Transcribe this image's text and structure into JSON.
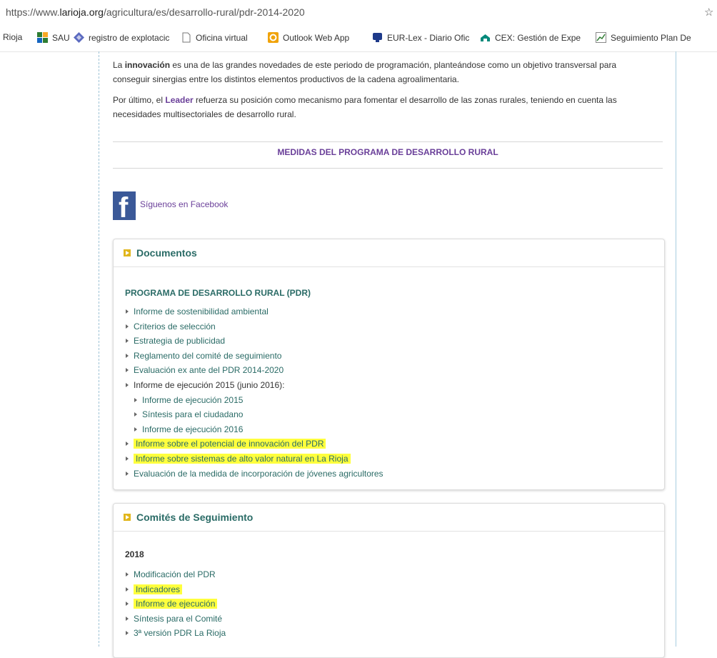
{
  "browser": {
    "url_prefix": "https://www.",
    "url_domain": "larioja.org",
    "url_path": "/agricultura/es/desarrollo-rural/pdr-2014-2020",
    "bookmarks": [
      {
        "label": "Rioja",
        "icon": "none"
      },
      {
        "label": "SAU",
        "icon": "sau-grid-icon"
      },
      {
        "label": "registro de explotacic",
        "icon": "diamond-icon"
      },
      {
        "label": "Oficina virtual",
        "icon": "page-icon"
      },
      {
        "label": "Outlook Web App",
        "icon": "outlook-icon"
      },
      {
        "label": "EUR-Lex - Diario Ofic",
        "icon": "eurlex-icon"
      },
      {
        "label": "CEX: Gestión de Expe",
        "icon": "cex-icon"
      },
      {
        "label": "Seguimiento Plan De",
        "icon": "chart-icon"
      }
    ]
  },
  "intro": {
    "p1_bold": "innovación",
    "p1_before": "La ",
    "p1_after_line1": " es una de las grandes novedades de este periodo de programación, planteándose como un objetivo transversal para",
    "p1_line2": "conseguir sinergias entre los distintos elementos productivos de la cadena agroalimentaria.",
    "p2_before": "Por último, el ",
    "p2_link": "Leader",
    "p2_after_line1": " refuerza su posición como mecanismo para fomentar el desarrollo de las zonas rurales, teniendo en cuenta las",
    "p2_line2": "necesidades multisectoriales de desarrollo rural."
  },
  "medidas_title": "MEDIDAS DEL PROGRAMA DE DESARROLLO RURAL",
  "facebook": {
    "icon_letter": "f",
    "link": "Síguenos en Facebook"
  },
  "documentos": {
    "title": "Documentos",
    "subtitle": "PROGRAMA DE DESARROLLO RURAL (PDR)",
    "items": [
      {
        "label": "Informe de sostenibilidad ambiental"
      },
      {
        "label": "Criterios de selección"
      },
      {
        "label": "Estrategia de publicidad"
      },
      {
        "label": "Reglamento del comité de seguimiento"
      },
      {
        "label": "Evaluación ex ante del PDR 2014-2020"
      },
      {
        "label": "Informe de ejecución 2015 (junio 2016):"
      },
      {
        "label": "Informe de ejecución 2015"
      },
      {
        "label": "Síntesis para el ciudadano"
      },
      {
        "label": "Informe de ejecución 2016"
      },
      {
        "label": "Informe sobre el potencial de innovación del PDR"
      },
      {
        "label": "Informe sobre sistemas de alto valor natural en La Rioja"
      },
      {
        "label": "Evaluación de la medida de incorporación de jóvenes agricultores"
      }
    ]
  },
  "comites": {
    "title": "Comités de Seguimiento",
    "year": "2018",
    "items": [
      {
        "label": "Modificación del PDR"
      },
      {
        "label": "Indicadores"
      },
      {
        "label": "Informe de ejecución"
      },
      {
        "label": "Síntesis para el Comité"
      },
      {
        "label": "3ª versión PDR La Rioja"
      }
    ]
  },
  "colors": {
    "link_teal": "#2a6b66",
    "purple": "#6a3f99",
    "highlight": "#ffff3d",
    "facebook": "#3b5998"
  }
}
